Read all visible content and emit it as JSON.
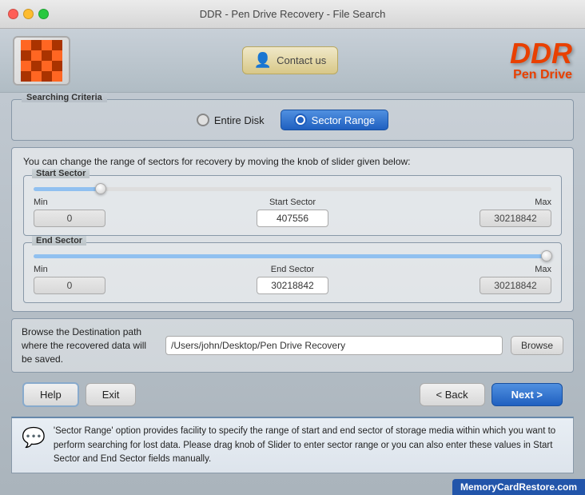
{
  "window": {
    "title": "DDR - Pen Drive Recovery - File Search"
  },
  "header": {
    "contact_label": "Contact us",
    "brand_name": "DDR",
    "brand_sub": "Pen Drive"
  },
  "search_criteria": {
    "section_label": "Searching Criteria",
    "option_entire_disk": "Entire Disk",
    "option_sector_range": "Sector Range",
    "active_option": "Sector Range"
  },
  "sector_panel": {
    "info_text": "You can change the range of sectors for recovery by moving the knob of slider given below:",
    "start_section": {
      "label": "Start Sector",
      "min_label": "Min",
      "min_value": "0",
      "start_label": "Start Sector",
      "start_value": "407556",
      "max_label": "Max",
      "max_value": "30218842",
      "slider_percent": 13
    },
    "end_section": {
      "label": "End Sector",
      "min_label": "Min",
      "min_value": "0",
      "end_label": "End Sector",
      "end_value": "30218842",
      "max_label": "Max",
      "max_value": "30218842",
      "slider_percent": 99
    }
  },
  "destination": {
    "label": "Browse the Destination path where the recovered data will be saved.",
    "path": "/Users/john/Desktop/Pen Drive Recovery",
    "browse_label": "Browse"
  },
  "buttons": {
    "help": "Help",
    "exit": "Exit",
    "back": "< Back",
    "next": "Next >"
  },
  "info": {
    "text": "'Sector Range' option provides facility to specify the range of start and end sector of storage media within which you want to perform searching for lost data. Please drag knob of Slider to enter sector range or you can also enter these values in Start Sector and End Sector fields manually."
  },
  "watermark": "MemoryCardRestore.com"
}
